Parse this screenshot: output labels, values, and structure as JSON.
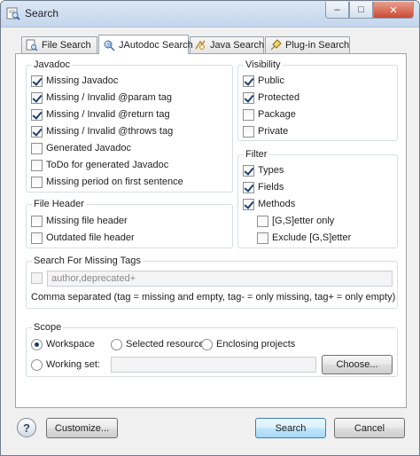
{
  "window": {
    "title": "Search",
    "minimize": "–",
    "maximize": "□",
    "close": "✕"
  },
  "tabs": [
    {
      "label": "File Search",
      "icon": "file-search-icon"
    },
    {
      "label": "JAutodoc Search",
      "icon": "jautodoc-search-icon",
      "active": true
    },
    {
      "label": "Java Search",
      "icon": "java-search-icon"
    },
    {
      "label": "Plug-in Search",
      "icon": "plugin-search-icon"
    }
  ],
  "javadoc": {
    "title": "Javadoc",
    "items": [
      {
        "label": "Missing Javadoc",
        "checked": true
      },
      {
        "label": "Missing / Invalid @param tag",
        "checked": true
      },
      {
        "label": "Missing / Invalid @return tag",
        "checked": true
      },
      {
        "label": "Missing / Invalid @throws tag",
        "checked": true
      },
      {
        "label": "Generated Javadoc",
        "checked": false
      },
      {
        "label": "ToDo for generated Javadoc",
        "checked": false
      },
      {
        "label": "Missing period on first sentence",
        "checked": false
      }
    ]
  },
  "visibility": {
    "title": "Visibility",
    "items": [
      {
        "label": "Public",
        "checked": true
      },
      {
        "label": "Protected",
        "checked": true
      },
      {
        "label": "Package",
        "checked": false
      },
      {
        "label": "Private",
        "checked": false
      }
    ]
  },
  "file_header": {
    "title": "File Header",
    "items": [
      {
        "label": "Missing file header",
        "checked": false
      },
      {
        "label": "Outdated file header",
        "checked": false
      }
    ]
  },
  "filter": {
    "title": "Filter",
    "items": [
      {
        "label": "Types",
        "checked": true
      },
      {
        "label": "Fields",
        "checked": true
      },
      {
        "label": "Methods",
        "checked": true
      },
      {
        "label": "[G,S]etter only",
        "checked": false
      },
      {
        "label": "Exclude [G,S]etter",
        "checked": false
      }
    ]
  },
  "missing_tags": {
    "title": "Search For Missing Tags",
    "value": "author,deprecated+",
    "hint": "Comma separated (tag = missing and empty, tag- = only missing, tag+ = only empty)"
  },
  "scope": {
    "title": "Scope",
    "workspace": "Workspace",
    "selected_resources": "Selected resources",
    "enclosing_projects": "Enclosing projects",
    "working_set": "Working set:",
    "choose": "Choose..."
  },
  "footer": {
    "help": "?",
    "customize": "Customize...",
    "search": "Search",
    "cancel": "Cancel"
  }
}
